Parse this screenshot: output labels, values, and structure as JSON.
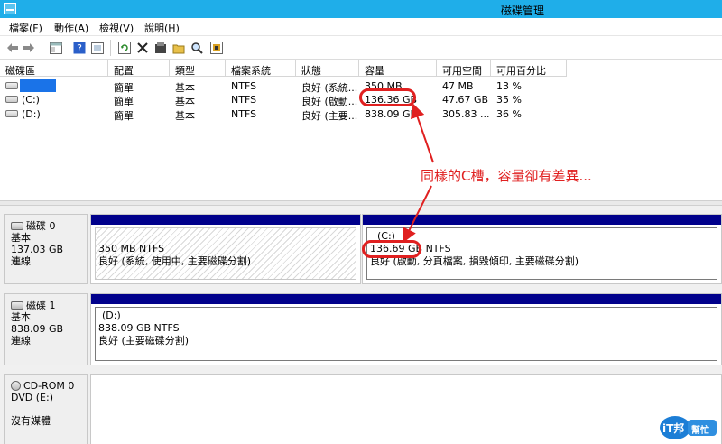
{
  "window": {
    "title": "磁碟管理"
  },
  "menu": [
    "檔案(F)",
    "動作(A)",
    "檢視(V)",
    "說明(H)"
  ],
  "toolbar": {
    "icons": [
      "back-icon",
      "forward-icon",
      "console-tree-icon",
      "help-icon",
      "view-icon",
      "refresh-icon",
      "delete-icon",
      "properties-icon",
      "open-icon",
      "search-icon",
      "settings-icon"
    ]
  },
  "volumes": {
    "columns": [
      "磁碟區",
      "配置",
      "類型",
      "檔案系統",
      "狀態",
      "容量",
      "可用空間",
      "可用百分比"
    ],
    "rows": [
      {
        "name": "",
        "layout": "簡單",
        "type": "基本",
        "fs": "NTFS",
        "status": "良好 (系統...",
        "capacity": "350 MB",
        "free": "47 MB",
        "pct": "13 %"
      },
      {
        "name": "(C:)",
        "layout": "簡單",
        "type": "基本",
        "fs": "NTFS",
        "status": "良好 (啟動...",
        "capacity": "136.36 GB",
        "free": "47.67 GB",
        "pct": "35 %"
      },
      {
        "name": "(D:)",
        "layout": "簡單",
        "type": "基本",
        "fs": "NTFS",
        "status": "良好 (主要...",
        "capacity": "838.09 GB",
        "free": "305.83 ...",
        "pct": "36 %"
      }
    ]
  },
  "disks": [
    {
      "name": "磁碟 0",
      "type": "基本",
      "size": "137.03 GB",
      "state": "連線",
      "partitions": [
        {
          "label": "",
          "size": "350 MB NTFS",
          "status": "良好 (系統, 使用中, 主要磁碟分割)"
        },
        {
          "label": "(C:)",
          "size": "136.69 GB",
          "fs": "NTFS",
          "status": "良好 (啟動, 分頁檔案, 損毀傾印, 主要磁碟分割)"
        }
      ]
    },
    {
      "name": "磁碟 1",
      "type": "基本",
      "size": "838.09 GB",
      "state": "連線",
      "partitions": [
        {
          "label": "(D:)",
          "size": "838.09 GB NTFS",
          "status": "良好 (主要磁碟分割)"
        }
      ]
    },
    {
      "name": "CD-ROM 0",
      "type": "DVD (E:)",
      "size": "",
      "state": "沒有媒體"
    }
  ],
  "annotation": {
    "text": "同樣的C槽，容量卻有差異...",
    "color": "#e02020"
  },
  "watermark": {
    "text1": "iT邦",
    "text2": "幫忙"
  },
  "colors": {
    "titlebar": "#1faee9",
    "partition_header": "#00008b",
    "annotation": "#e02020"
  }
}
